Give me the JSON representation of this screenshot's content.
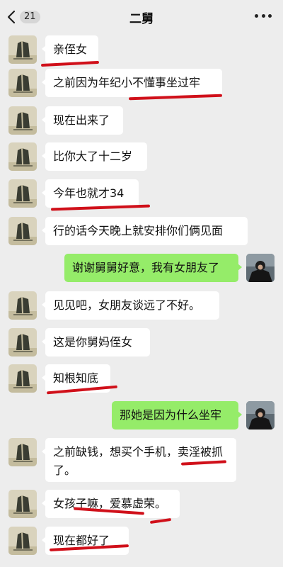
{
  "header": {
    "title": "二舅",
    "unread_badge": "21",
    "back_icon": "chevron-left-icon",
    "more_icon": "more-dots-icon"
  },
  "colors": {
    "background": "#ededed",
    "incoming_bubble": "#ffffff",
    "outgoing_bubble": "#95ec69",
    "annotation_red": "#d0101a"
  },
  "messages": [
    {
      "sender": "contact",
      "text": "亲侄女"
    },
    {
      "sender": "contact",
      "text": "之前因为年纪小不懂事坐过牢"
    },
    {
      "sender": "contact",
      "text": "现在出来了"
    },
    {
      "sender": "contact",
      "text": "比你大了十二岁"
    },
    {
      "sender": "contact",
      "text": "今年也就才34"
    },
    {
      "sender": "contact",
      "text": "行的话今天晚上就安排你们俩见面"
    },
    {
      "sender": "me",
      "text": "谢谢舅舅好意，我有女朋友了"
    },
    {
      "sender": "contact",
      "text": "见见吧，女朋友谈远了不好。"
    },
    {
      "sender": "contact",
      "text": "这是你舅妈侄女"
    },
    {
      "sender": "contact",
      "text": "知根知底"
    },
    {
      "sender": "me",
      "text": "那她是因为什么坐牢"
    },
    {
      "sender": "contact",
      "text": "之前缺钱，想买个手机，卖淫被抓\n了。"
    },
    {
      "sender": "contact",
      "text": "女孩子嘛，爱慕虚荣。"
    },
    {
      "sender": "contact",
      "text": "现在都好了"
    }
  ]
}
